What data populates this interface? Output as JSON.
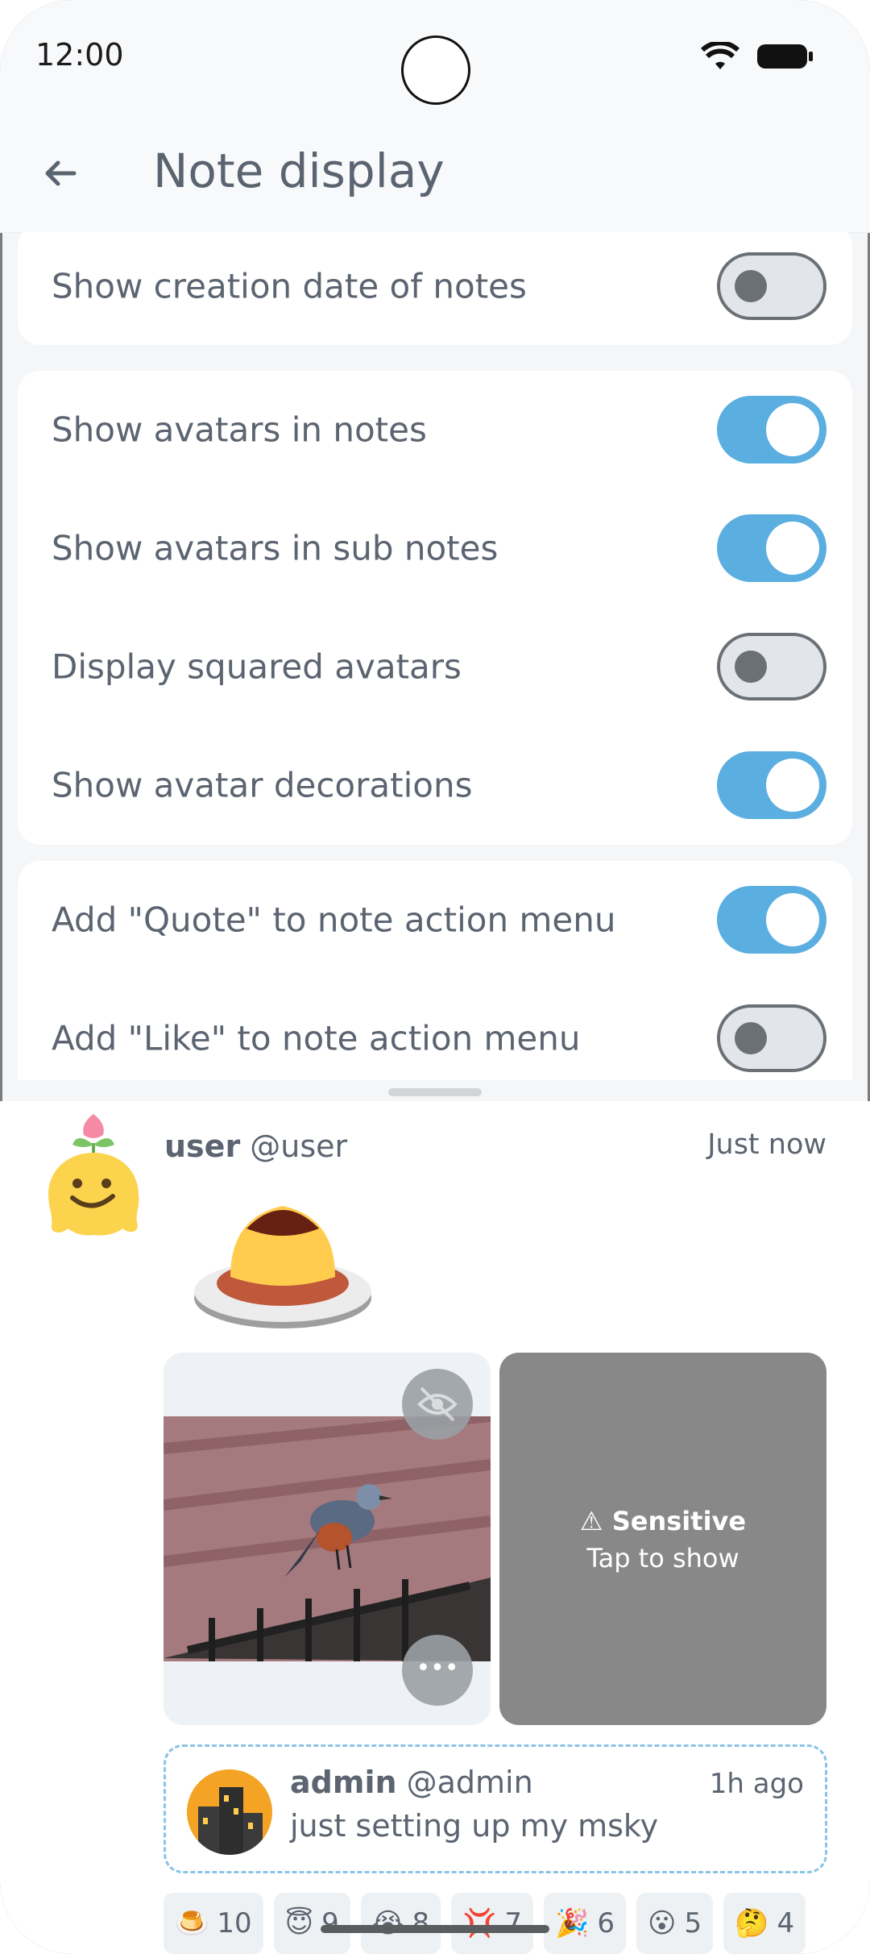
{
  "status_bar": {
    "time": "12:00"
  },
  "app_bar": {
    "title": "Note display"
  },
  "colors": {
    "accent": "#5aaee0",
    "switch_off": "#e2e6ea",
    "sensitive_bg": "#888888"
  },
  "settings": {
    "card1": [
      {
        "label": "Show creation date of notes",
        "on": false
      }
    ],
    "card2": [
      {
        "label": "Show avatars in notes",
        "on": true
      },
      {
        "label": "Show avatars in sub notes",
        "on": true
      },
      {
        "label": "Display squared avatars",
        "on": false
      },
      {
        "label": "Show avatar decorations",
        "on": true
      }
    ],
    "card3": [
      {
        "label": "Add \"Quote\" to note action menu",
        "on": true
      },
      {
        "label": "Add \"Like\" to note action menu",
        "on": false
      }
    ]
  },
  "preview": {
    "user_name": "user",
    "user_handle": "@user",
    "time": "Just now",
    "sensitive_title": "Sensitive",
    "sensitive_sub": "Tap to show",
    "quote": {
      "name": "admin",
      "handle": "@admin",
      "time": "1h ago",
      "text": "just setting up my msky"
    },
    "reactions": [
      {
        "emoji": "🍮",
        "count": "10"
      },
      {
        "emoji": "😇",
        "count": "9"
      },
      {
        "emoji": "😭",
        "count": "8"
      },
      {
        "emoji": "💢",
        "count": "7"
      },
      {
        "emoji": "🎉",
        "count": "6"
      },
      {
        "emoji": "😮",
        "count": "5"
      },
      {
        "emoji": "🤔",
        "count": "4"
      }
    ]
  }
}
